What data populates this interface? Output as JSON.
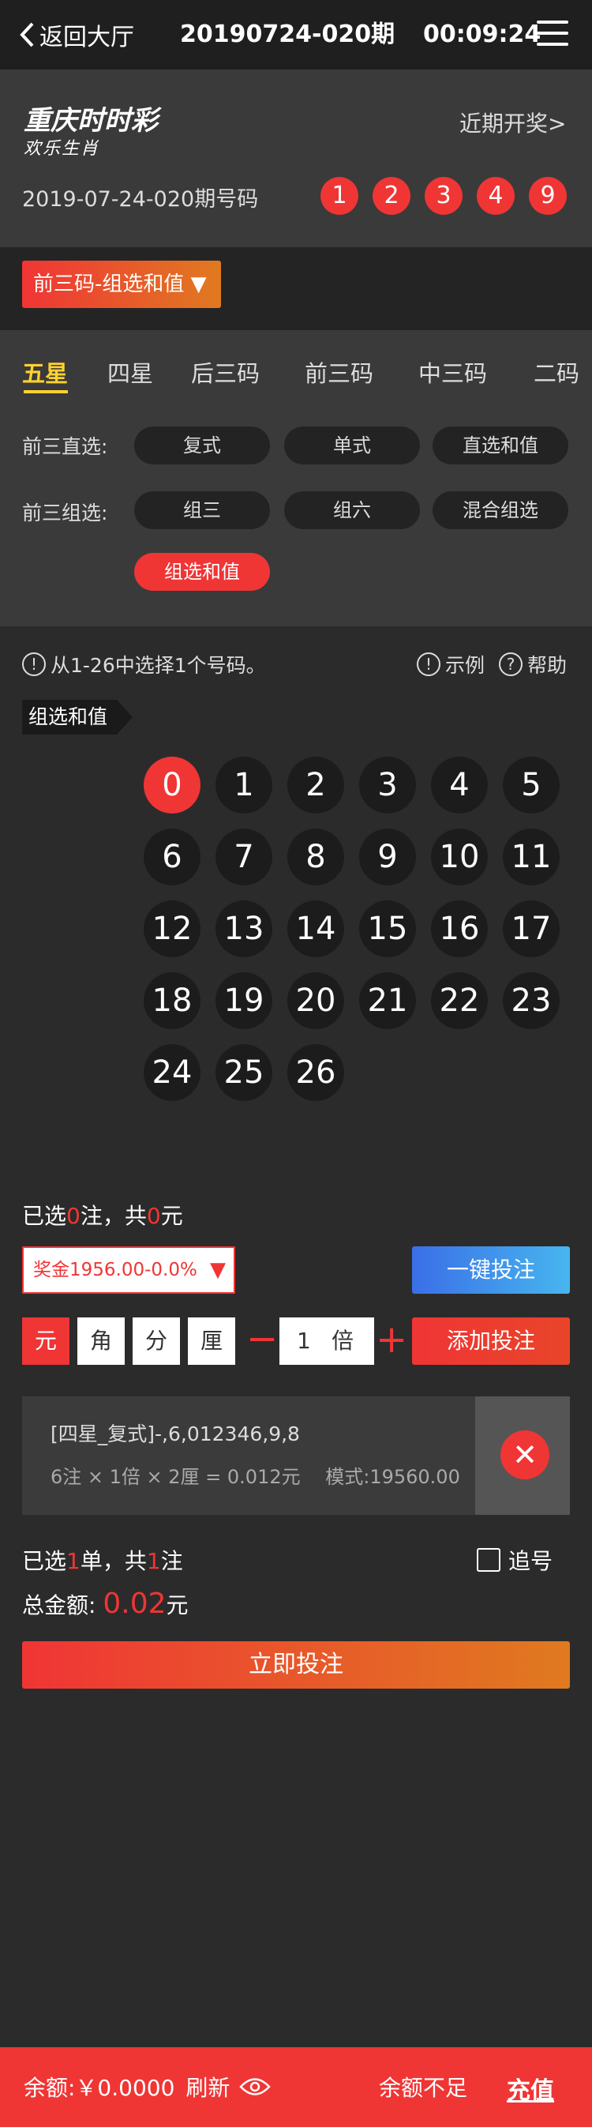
{
  "header": {
    "back_label": "返回大厅",
    "period": "20190724-020期",
    "timer": "00:09:24"
  },
  "lottery": {
    "logo_main": "重庆时时彩",
    "logo_sub": "欢乐生肖",
    "recent_link": "近期开奖>",
    "draw_label": "2019-07-24-020期号码",
    "draw_numbers": [
      "1",
      "2",
      "3",
      "4",
      "9"
    ]
  },
  "mode": {
    "selected": "前三码-组选和值 ▼"
  },
  "tabs": [
    "五星",
    "四星",
    "后三码",
    "前三码",
    "中三码",
    "二码"
  ],
  "direct": {
    "label": "前三直选:",
    "options": [
      "复式",
      "单式",
      "直选和值"
    ]
  },
  "group": {
    "label": "前三组选:",
    "options": [
      "组三",
      "组六",
      "混合组选",
      "组选和值"
    ]
  },
  "hint": {
    "text": "从1-26中选择1个号码。",
    "example": "示例",
    "help": "帮助"
  },
  "section_tag": "组选和值",
  "numbers": [
    "0",
    "1",
    "2",
    "3",
    "4",
    "5",
    "6",
    "7",
    "8",
    "9",
    "10",
    "11",
    "12",
    "13",
    "14",
    "15",
    "16",
    "17",
    "18",
    "19",
    "20",
    "21",
    "22",
    "23",
    "24",
    "25",
    "26"
  ],
  "selected_number": "0",
  "selection_summary": {
    "prefix": "已选",
    "count": "0",
    "mid": "注，共",
    "amount": "0",
    "suffix": "元"
  },
  "prize": {
    "text": "奖金1956.00-0.0%",
    "arrow": "▼"
  },
  "quick_bet": "一键投注",
  "units": [
    "元",
    "角",
    "分",
    "厘"
  ],
  "active_unit": "元",
  "multiplier": {
    "value": "1",
    "label": "倍",
    "minus": "−",
    "plus": "+"
  },
  "add_bet": "添加投注",
  "bet_item": {
    "line1": "[四星_复式]-,6,012346,9,8",
    "line2": "6注 × 1倍 × 2厘 = 0.012元　 模式:19560.00",
    "delete": "✕"
  },
  "order_summary": {
    "prefix": "已选",
    "orders": "1",
    "mid": "单，共",
    "bets": "1",
    "suffix": "注"
  },
  "chase_label": "追号",
  "total": {
    "label": "总金额:",
    "amount": "0.02",
    "unit": "元"
  },
  "submit": "立即投注",
  "footer": {
    "balance": "余额:￥0.0000",
    "refresh": "刷新",
    "insufficient": "余额不足",
    "recharge": "充值"
  }
}
